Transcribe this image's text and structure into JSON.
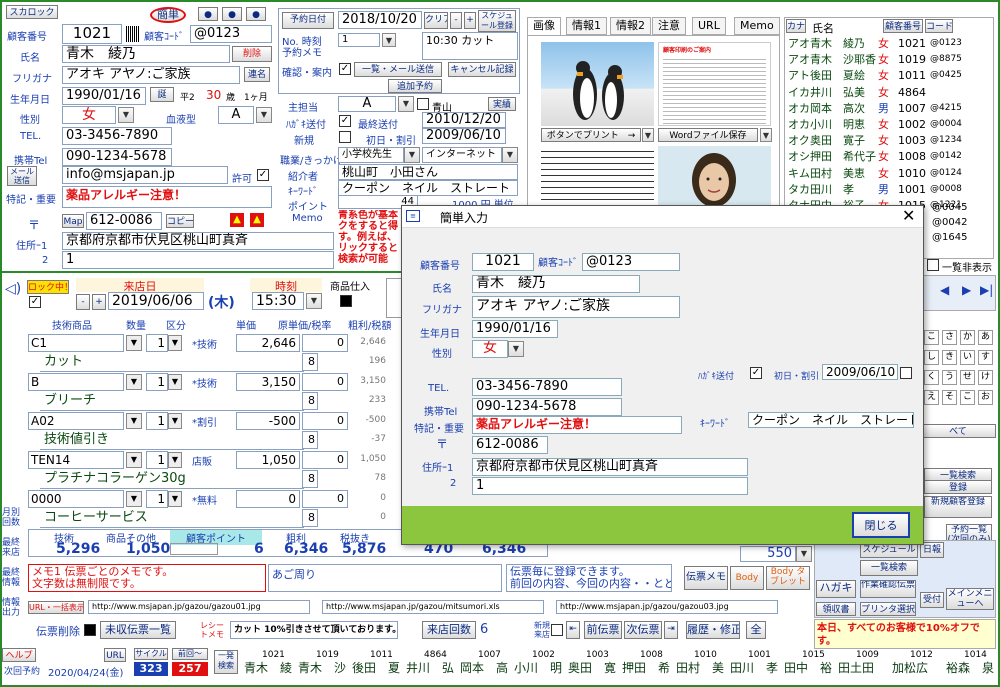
{
  "top": {
    "scroll_btn": "スカロック",
    "simple_btn": "簡単",
    "customer_no_label": "顧客番号",
    "customer_no": "1021",
    "customer_code_label": "顧客ｺｰﾄﾞ",
    "customer_code": "@0123",
    "name_label": "氏名",
    "name": "青木　綾乃",
    "delete_btn": "削除",
    "kana_label": "フリガナ",
    "kana": "アオキ アヤノ:ご家族",
    "union_btn": "連名",
    "birthday_label": "生年月日",
    "birthday": "1990/01/16",
    "birth_btn": "誕",
    "era": "平2",
    "age": "30",
    "age_unit": "歳",
    "age_month": "1ヶ月",
    "gender_label": "性別",
    "gender": "女",
    "blood_label": "血液型",
    "blood": "A",
    "tel_label": "TEL.",
    "tel": "03-3456-7890",
    "mobile_label": "携帯Tel",
    "mobile": "090-1234-5678",
    "mail_btn": "メール送信",
    "email": "info@msjapan.jp",
    "permit_label": "許可",
    "notes_label": "特記・重要",
    "notes": "薬品アレルギー注意！",
    "zip_label": "〒",
    "map_btn": "Map",
    "zip": "612-0086",
    "copy_btn": "コピー",
    "addr1_label": "住所ｰ1",
    "addr1": "京都府京都市伏見区桃山町真斉",
    "addr2_label": "2",
    "addr2": "1"
  },
  "mid": {
    "reserve_date_btn": "予約日付",
    "reserve_date": "2018/10/20",
    "clear_btn": "クリア",
    "plus": "+",
    "minus": "-",
    "schedule_btn": "スケジュール登録",
    "no_time_label": "No. 時刻",
    "reserve_memo_label": "予約メモ",
    "no_val": "1",
    "reserve_memo": "10:30 カット",
    "confirm_label": "確認・案内",
    "list_mail_btn": "一覧・メール送信",
    "cancel_btn": "キャンセル記録",
    "add_reserve_btn": "追加予約",
    "main_staff_label": "主担当",
    "main_staff": "A",
    "aoyama": "青山",
    "actual_btn": "実績",
    "postcard_label": "ﾊｶﾞｷ送付",
    "last_sent_label": "最終送付",
    "last_sent": "2010/12/20",
    "new_label": "新規",
    "first_label": "初日・割引",
    "first_date": "2009/06/10",
    "job_label": "職業/きっかけ",
    "job": "小学校先生",
    "trigger": "インターネット",
    "intro_label": "紹介者",
    "intro": "桃山町　小田さん",
    "keyword_label": "ｷｰﾜｰﾄﾞ",
    "keyword": "クーポン　ネイル　ストレート",
    "point_label": "ポイント",
    "point": "44",
    "point_unit": "1000 円 単位",
    "memo_label": "Memo",
    "memo": "青系色が基本\nクをすると得\nす。例えば、\nリックすると\n検索が可能"
  },
  "tabs": [
    "画像",
    "情報1",
    "情報2",
    "注意",
    "URL",
    "Memo"
  ],
  "images": {
    "print_btn": "ボタンでプリント　→",
    "word_btn": "Wordファイル保存",
    "doc_title": "顧客印刷のご案内"
  },
  "customer_list": {
    "header_kana": "カナ",
    "header_name": "氏名",
    "customer_no_btn": "顧客番号",
    "code_btn": "コード",
    "rows": [
      {
        "kana": "アオ",
        "name": "青木　綾乃",
        "sex": "女",
        "no": "1021",
        "code": "@0123"
      },
      {
        "kana": "アオ",
        "name": "青木　沙耶香",
        "sex": "女",
        "no": "1019",
        "code": "@8875"
      },
      {
        "kana": "アト",
        "name": "後田　夏絵",
        "sex": "女",
        "no": "1011",
        "code": "@0425"
      },
      {
        "kana": "イカ",
        "name": "井川　弘美",
        "sex": "女",
        "no": "4864",
        "code": ""
      },
      {
        "kana": "オカ",
        "name": "岡本　高次",
        "sex": "男",
        "no": "1007",
        "code": "@4215"
      },
      {
        "kana": "オカ",
        "name": "小川　明恵",
        "sex": "女",
        "no": "1002",
        "code": "@0004"
      },
      {
        "kana": "オク",
        "name": "奥田　寛子",
        "sex": "女",
        "no": "1003",
        "code": "@1234"
      },
      {
        "kana": "オシ",
        "name": "押田　希代子",
        "sex": "女",
        "no": "1008",
        "code": "@0142"
      },
      {
        "kana": "キム",
        "name": "田村　美恵",
        "sex": "女",
        "no": "1010",
        "code": "@0124"
      },
      {
        "kana": "タカ",
        "name": "田川　孝",
        "sex": "男",
        "no": "1001",
        "code": "@0008"
      },
      {
        "kana": "タナ",
        "name": "田中　裕子",
        "sex": "女",
        "no": "1015",
        "code": "@1221"
      }
    ],
    "extra_codes": [
      "@0045",
      "@0042",
      "@1645"
    ],
    "list_display": "一覧非表示"
  },
  "visit": {
    "lock_btn": "ロック中！",
    "visit_date_label": "来店日",
    "visit_date": "2019/06/06",
    "weekday": "(木)",
    "time_label": "時刻",
    "time": "15:30",
    "goods_label": "商品仕入",
    "col_item": "技術商品",
    "col_qty": "数量",
    "col_class": "区分",
    "col_price": "単価",
    "col_cost": "原単価/税率",
    "col_profit": "粗利/税額",
    "rows": [
      {
        "code": "C1",
        "qty": "1",
        "cls": "*技術",
        "price": "2,646",
        "cost": "0",
        "profit": "2,646",
        "rate": "8",
        "tax": "196",
        "name": "カット"
      },
      {
        "code": "B",
        "qty": "1",
        "cls": "*技術",
        "price": "3,150",
        "cost": "0",
        "profit": "3,150",
        "rate": "8",
        "tax": "233",
        "name": "ブリーチ"
      },
      {
        "code": "A02",
        "qty": "1",
        "cls": "*割引",
        "price": "-500",
        "cost": "0",
        "profit": "-500",
        "rate": "8",
        "tax": "-37",
        "name": "技術値引き"
      },
      {
        "code": "TEN14",
        "qty": "1",
        "cls": "店販",
        "price": "1,050",
        "cost": "0",
        "profit": "1,050",
        "rate": "8",
        "tax": "78",
        "name": "プラチナコラーゲン30g"
      },
      {
        "code": "0000",
        "qty": "1",
        "cls": "*無料",
        "price": "0",
        "cost": "0",
        "profit": "0",
        "rate": "8",
        "tax": "0",
        "name": "コーヒーサービス"
      }
    ]
  },
  "totals": {
    "tech_label": "技術",
    "goods_label": "商品その他",
    "point_label": "顧客ポイント",
    "gross_label": "粗利",
    "excl_label": "税抜き",
    "tech": "5,296",
    "goods": "1,050",
    "point": "6",
    "gross": "6,346",
    "excl": "5,876",
    "tax": "470",
    "total": "6,346",
    "change": "550"
  },
  "memo_area": {
    "memo1": "メモ1 伝票ごとのメモです。\n文字数は無制限です。",
    "memo2": "あご周り",
    "memo3": "伝票毎に登録できます。\n前回の内容、今回の内容・・とど",
    "slip_memo_btn": "伝票メモ",
    "body_btn": "Body",
    "body_tablet_btn": "Body タブレット",
    "url_btn": "URL・一括表示",
    "url1": "http://www.msjapan.jp/gazou/gazou01.jpg",
    "url2": "http://www.msjapan.jp/gazou/mitsumori.xls",
    "url3": "http://www.msjapan.jp/gazou/gazou03.jpg"
  },
  "bottom": {
    "slip_delete": "伝票削除",
    "unpaid_list": "未収伝票一覧",
    "receipt_memo_label": "レシートメモ",
    "receipt_memo": "カット 10%引きさせて頂いております。",
    "visit_count_label": "来店回数",
    "visit_count": "6",
    "new_visit": "新規来店",
    "prev_slip": "前伝票",
    "next_slip": "次伝票",
    "history": "履歴・修正",
    "all": "全",
    "help": "ヘルプ",
    "next_reserve": "次回予約",
    "next_date": "2020/04/24(金)",
    "cycle_label": "サイクル",
    "cycle": "323",
    "prev_label": "前回～",
    "prev": "257",
    "search_label": "一発検索",
    "notice": "本日、すべてのお客様で10%オフです。",
    "left_labels": [
      "月別回数",
      "最終来店",
      "最終情報",
      "情報出力"
    ],
    "names": [
      {
        "id": "1021",
        "name": "青木　綾"
      },
      {
        "id": "1019",
        "name": "青木　沙"
      },
      {
        "id": "1011",
        "name": "後田　夏"
      },
      {
        "id": "4864",
        "name": "井川　弘"
      },
      {
        "id": "1007",
        "name": "岡本　高"
      },
      {
        "id": "1002",
        "name": "小川　明"
      },
      {
        "id": "1003",
        "name": "奥田　寛"
      },
      {
        "id": "1008",
        "name": "押田　希"
      },
      {
        "id": "1010",
        "name": "田村　美"
      },
      {
        "id": "1001",
        "name": "田川　孝"
      },
      {
        "id": "1015",
        "name": "田中　裕"
      },
      {
        "id": "1009",
        "name": "田土田"
      },
      {
        "id": "1012",
        "name": "加松広"
      },
      {
        "id": "1014",
        "name": "裕森　泉"
      }
    ]
  },
  "right_panel": {
    "kana_keys": [
      "こ",
      "さ",
      "か",
      "あ",
      "し",
      "き",
      "い",
      "す",
      "く",
      "う",
      "せ",
      "け",
      "え",
      "そ",
      "こ",
      "お"
    ],
    "all_btn": "べて",
    "list_search_btn": "一覧検索",
    "register_btn": "登録",
    "new_register_btn": "新規顧客登録",
    "reserve_list_btn": "予約一覧(次回のみ)",
    "schedule_btn": "スケジュール",
    "list_search2_btn": "一覧検索",
    "daily_btn": "日報",
    "postcard_btn": "ハガキ",
    "work_btn": "作業確認伝票",
    "receive_btn": "受付",
    "main_menu_btn": "メインメニューへ",
    "receipt_btn": "領収書",
    "printer_btn": "プリンタ選択",
    "sales_btn": "売上"
  },
  "modal": {
    "title": "簡単入力",
    "customer_no_label": "顧客番号",
    "customer_no": "1021",
    "customer_code_label": "顧客ｺｰﾄﾞ",
    "customer_code": "@0123",
    "name_label": "氏名",
    "name": "青木　綾乃",
    "kana_label": "フリガナ",
    "kana": "アオキ アヤノ:ご家族",
    "birthday_label": "生年月日",
    "birthday": "1990/01/16",
    "gender_label": "性別",
    "gender": "女",
    "postcard_label": "ﾊｶﾞｷ送付",
    "first_label": "初日・割引",
    "first_date": "2009/06/10",
    "tel_label": "TEL.",
    "tel": "03-3456-7890",
    "mobile_label": "携帯Tel",
    "mobile": "090-1234-5678",
    "notes_label": "特記・重要",
    "notes": "薬品アレルギー注意！",
    "keyword_label": "ｷｰﾜｰﾄﾞ",
    "keyword": "クーポン　ネイル　ストレート",
    "zip_label": "〒",
    "zip": "612-0086",
    "addr1_label": "住所ｰ1",
    "addr1": "京都府京都市伏見区桃山町真斉",
    "addr2_label": "2",
    "addr2": "1",
    "close_btn": "閉じる"
  }
}
